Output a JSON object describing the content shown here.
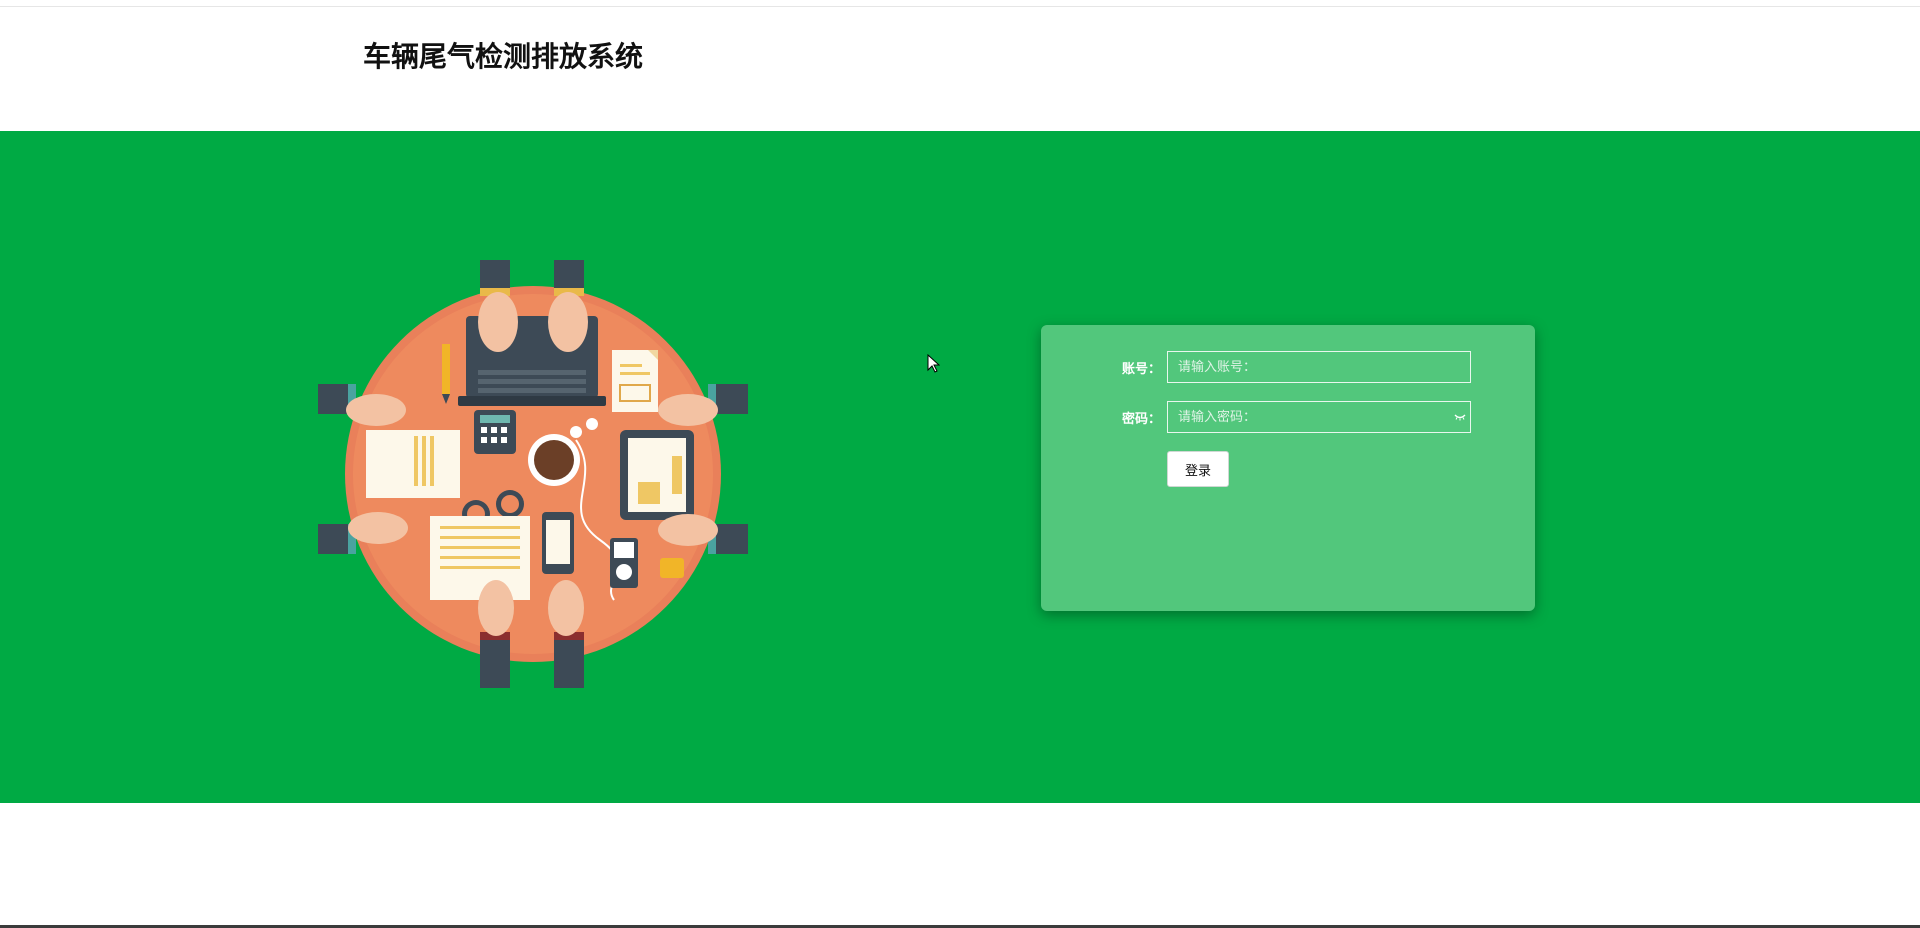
{
  "header": {
    "title": "车辆尾气检测排放系统"
  },
  "login": {
    "account_label": "账号：",
    "account_placeholder": "请输入账号：",
    "account_value": "",
    "password_label": "密码：",
    "password_placeholder": "请输入密码：",
    "password_value": "",
    "submit_label": "登录"
  },
  "icons": {
    "illustration": "team-meeting-table-illustration",
    "password_toggle": "eye-closed-icon",
    "cursor": "mouse-pointer-icon"
  },
  "colors": {
    "banner": "#00aa44",
    "panel": "#52c77c",
    "table": "#ee8a5e",
    "text_white": "#ffffff"
  }
}
